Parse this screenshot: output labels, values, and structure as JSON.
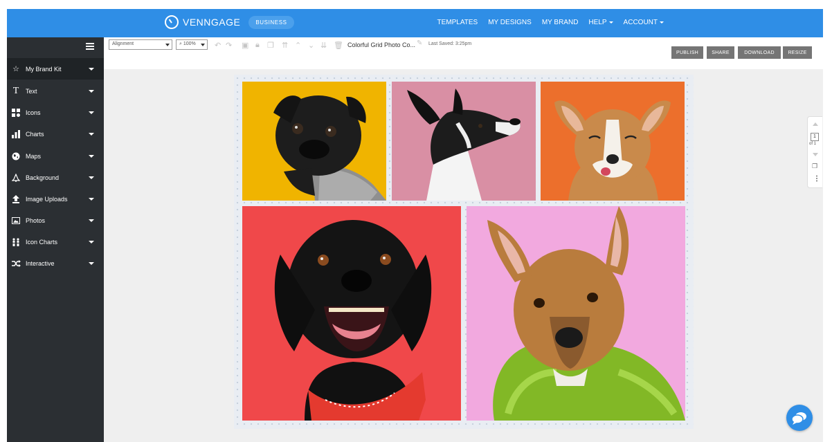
{
  "app": {
    "logo_text": "VENNGAGE",
    "plan_badge": "BUSINESS",
    "accent_color": "#2f8ee6"
  },
  "topnav": {
    "templates": "TEMPLATES",
    "my_designs": "MY DESIGNS",
    "my_brand": "MY BRAND",
    "help": "HELP",
    "account": "ACCOUNT"
  },
  "sidebar": {
    "items": [
      {
        "label": "My Brand Kit",
        "icon": "star-icon"
      },
      {
        "label": "Text",
        "icon": "text-icon"
      },
      {
        "label": "Icons",
        "icon": "icons-grid-icon"
      },
      {
        "label": "Charts",
        "icon": "bar-chart-icon"
      },
      {
        "label": "Maps",
        "icon": "globe-icon"
      },
      {
        "label": "Background",
        "icon": "bell-icon"
      },
      {
        "label": "Image Uploads",
        "icon": "upload-icon"
      },
      {
        "label": "Photos",
        "icon": "photo-icon"
      },
      {
        "label": "Icon Charts",
        "icon": "people-icon"
      },
      {
        "label": "Interactive",
        "icon": "shuffle-icon"
      }
    ]
  },
  "toolbar": {
    "alignment": "Alignment",
    "zoom": "100%",
    "document_title": "Colorful Grid Photo Co...",
    "last_saved": "Last Saved: 3:25pm",
    "publish": "PUBLISH",
    "share": "SHARE",
    "download": "DOWNLOAD",
    "resize": "RESIZE"
  },
  "pager": {
    "current": "1",
    "of_label": "of 1"
  },
  "photos": [
    {
      "name": "pug-photo",
      "bg": "#f0b400"
    },
    {
      "name": "black-white-dog-photo",
      "bg": "#d98fa4"
    },
    {
      "name": "corgi-photo",
      "bg": "#ec6f2c"
    },
    {
      "name": "black-dog-photo",
      "bg": "#f0484a"
    },
    {
      "name": "brown-dog-photo",
      "bg": "#f2a9df"
    }
  ]
}
